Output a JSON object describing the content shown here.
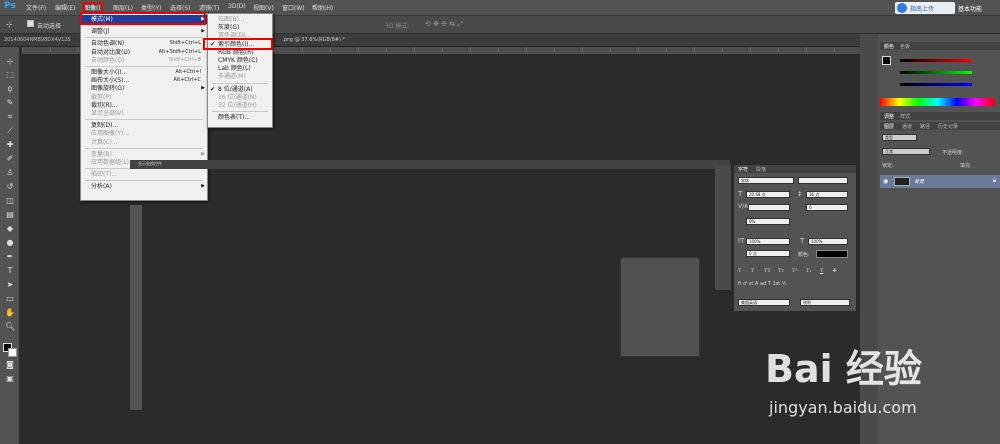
{
  "menubar": {
    "logo": "Ps",
    "items": [
      "文件(F)",
      "编辑(E)",
      "图像(I)",
      "图层(L)",
      "类型(Y)",
      "选择(S)",
      "滤镜(T)",
      "3D(D)",
      "视图(V)",
      "窗口(W)",
      "帮助(H)"
    ],
    "share": "指南上传",
    "workspace": "基本功能"
  },
  "optbar": {
    "auto_select": "自动选择",
    "mode3d": "3D 模式:"
  },
  "tabs": {
    "left": "20140604NMB98DX4V125",
    "right": ".png @ 37.6%(RGB/8#) *"
  },
  "image_menu": [
    {
      "label": "模式(M)",
      "sc": "",
      "sub": true,
      "dis": false
    },
    {
      "sep": true
    },
    {
      "label": "调整(J)",
      "sc": "",
      "sub": true,
      "dis": false
    },
    {
      "sep": true
    },
    {
      "label": "自动色调(N)",
      "sc": "Shift+Ctrl+L",
      "dis": false
    },
    {
      "label": "自动对比度(U)",
      "sc": "Alt+Shift+Ctrl+L",
      "dis": false
    },
    {
      "label": "自动颜色(O)",
      "sc": "Shift+Ctrl+B",
      "dis": true
    },
    {
      "sep": true
    },
    {
      "label": "图像大小(I)...",
      "sc": "Alt+Ctrl+I",
      "dis": false
    },
    {
      "label": "画布大小(S)...",
      "sc": "Alt+Ctrl+C",
      "dis": false
    },
    {
      "label": "图像旋转(G)",
      "sc": "",
      "sub": true,
      "dis": false
    },
    {
      "label": "裁剪(P)",
      "sc": "",
      "dis": true
    },
    {
      "label": "裁切(R)...",
      "sc": "",
      "dis": false
    },
    {
      "label": "显示全部(V)",
      "sc": "",
      "dis": true
    },
    {
      "sep": true
    },
    {
      "label": "复制(D)...",
      "sc": "",
      "dis": false
    },
    {
      "label": "应用图像(Y)...",
      "sc": "",
      "dis": true
    },
    {
      "label": "计算(C)...",
      "sc": "",
      "dis": true
    },
    {
      "sep": true
    },
    {
      "label": "变量(B)",
      "sc": "",
      "sub": true,
      "dis": true
    },
    {
      "label": "应用数据组(L)...",
      "sc": "",
      "dis": true
    },
    {
      "sep": true
    },
    {
      "label": "陷印(T)...",
      "sc": "",
      "dis": true
    },
    {
      "sep": true
    },
    {
      "label": "分析(A)",
      "sc": "",
      "sub": true,
      "dis": false
    }
  ],
  "mode_menu": [
    {
      "label": "位图(B)...",
      "dis": true
    },
    {
      "label": "灰度(G)",
      "dis": false
    },
    {
      "label": "双色调(D)...",
      "dis": true
    },
    {
      "label": "索引颜色(I)...",
      "dis": false,
      "check": true
    },
    {
      "label": "RGB 颜色(R)",
      "dis": false
    },
    {
      "label": "CMYK 颜色(C)",
      "dis": false
    },
    {
      "label": "Lab 颜色(L)",
      "dis": false
    },
    {
      "label": "多通道(M)",
      "dis": true
    },
    {
      "sep": true
    },
    {
      "label": "8 位/通道(A)",
      "dis": false,
      "check": true
    },
    {
      "label": "16 位/通道(N)",
      "dis": true
    },
    {
      "label": "32 位/通道(H)",
      "dis": true
    },
    {
      "sep": true
    },
    {
      "label": "颜色表(T)...",
      "dis": false
    }
  ],
  "right_panel": {
    "color_tabs": [
      "颜色",
      "色板"
    ],
    "adjust_tabs": [
      "调整",
      "样式"
    ],
    "layer_tabs": [
      "图层",
      "通道",
      "路径",
      "历史记录"
    ],
    "kind": "类型",
    "blend": "正常",
    "opacity_label": "不透明度:",
    "lock_label": "锁定:",
    "fill_label": "填充:",
    "layer_name": "背景"
  },
  "char_panel": {
    "tabs": [
      "字符",
      "段落"
    ],
    "font": "宋体",
    "size": "20.58 点",
    "leading": "36 点",
    "tracking": "0",
    "scale": "0%",
    "vscale": "100%",
    "hscale": "100%",
    "baseline": "0 点",
    "color_label": "颜色:",
    "lang": "美国英语",
    "aa": "锐利"
  },
  "small_panel_title": "显示变换控件",
  "colors": {
    "accent": "#31a8ff",
    "red_box": "#ee0000",
    "menu_highlight": "#1e3c9a"
  },
  "watermark": {
    "brand": "Bai 经验",
    "url": "jingyan.baidu.com"
  }
}
